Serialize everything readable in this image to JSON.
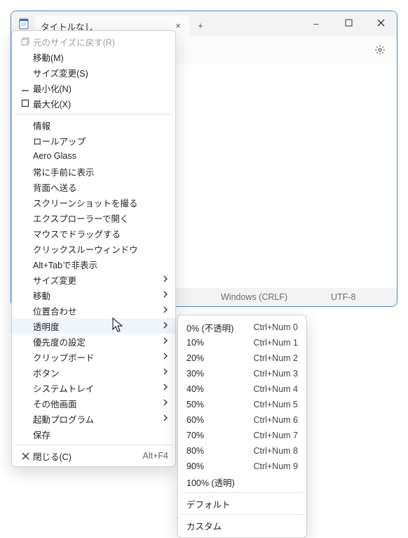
{
  "titlebar": {
    "tab_title": "タイトルなし",
    "tab_close": "×",
    "new_tab": "+",
    "minimize": "–",
    "maximize": "□",
    "close": "×"
  },
  "toolbar": {
    "settings": "⚙"
  },
  "statusbar": {
    "line_ending": "Windows (CRLF)",
    "encoding": "UTF-8"
  },
  "menu": {
    "items": [
      {
        "type": "item",
        "label": "元のサイズに戻す(R)",
        "icon": "restore",
        "disabled": true
      },
      {
        "type": "item",
        "label": "移動(M)"
      },
      {
        "type": "item",
        "label": "サイズ変更(S)"
      },
      {
        "type": "item",
        "label": "最小化(N)",
        "icon": "minimize"
      },
      {
        "type": "item",
        "label": "最大化(X)",
        "icon": "maximize"
      },
      {
        "type": "sep"
      },
      {
        "type": "item",
        "label": "情報"
      },
      {
        "type": "item",
        "label": "ロールアップ"
      },
      {
        "type": "item",
        "label": "Aero Glass"
      },
      {
        "type": "item",
        "label": "常に手前に表示"
      },
      {
        "type": "item",
        "label": "背面へ送る"
      },
      {
        "type": "item",
        "label": "スクリーンショットを撮る"
      },
      {
        "type": "item",
        "label": "エクスプローラーで開く"
      },
      {
        "type": "item",
        "label": "マウスでドラッグする"
      },
      {
        "type": "item",
        "label": "クリックスルーウィンドウ"
      },
      {
        "type": "item",
        "label": "Alt+Tabで非表示"
      },
      {
        "type": "item",
        "label": "サイズ変更",
        "submenu": true
      },
      {
        "type": "item",
        "label": "移動",
        "submenu": true
      },
      {
        "type": "item",
        "label": "位置合わせ",
        "submenu": true
      },
      {
        "type": "item",
        "label": "透明度",
        "submenu": true,
        "highlight": true
      },
      {
        "type": "item",
        "label": "優先度の設定",
        "submenu": true
      },
      {
        "type": "item",
        "label": "クリップボード",
        "submenu": true
      },
      {
        "type": "item",
        "label": "ボタン",
        "submenu": true
      },
      {
        "type": "item",
        "label": "システムトレイ",
        "submenu": true
      },
      {
        "type": "item",
        "label": "その他画面",
        "submenu": true
      },
      {
        "type": "item",
        "label": "起動プログラム",
        "submenu": true
      },
      {
        "type": "item",
        "label": "保存"
      },
      {
        "type": "sep"
      },
      {
        "type": "item",
        "label": "閉じる(C)",
        "icon": "close",
        "shortcut": "Alt+F4"
      }
    ]
  },
  "submenu": {
    "items": [
      {
        "label": "0% (不透明)",
        "shortcut": "Ctrl+Num 0"
      },
      {
        "label": "10%",
        "shortcut": "Ctrl+Num 1"
      },
      {
        "label": "20%",
        "shortcut": "Ctrl+Num 2"
      },
      {
        "label": "30%",
        "shortcut": "Ctrl+Num 3"
      },
      {
        "label": "40%",
        "shortcut": "Ctrl+Num 4"
      },
      {
        "label": "50%",
        "shortcut": "Ctrl+Num 5"
      },
      {
        "label": "60%",
        "shortcut": "Ctrl+Num 6"
      },
      {
        "label": "70%",
        "shortcut": "Ctrl+Num 7"
      },
      {
        "label": "80%",
        "shortcut": "Ctrl+Num 8"
      },
      {
        "label": "90%",
        "shortcut": "Ctrl+Num 9"
      },
      {
        "label": "100% (透明)"
      },
      {
        "type": "sep"
      },
      {
        "label": "デフォルト"
      },
      {
        "type": "sep"
      },
      {
        "label": "カスタム"
      }
    ]
  }
}
